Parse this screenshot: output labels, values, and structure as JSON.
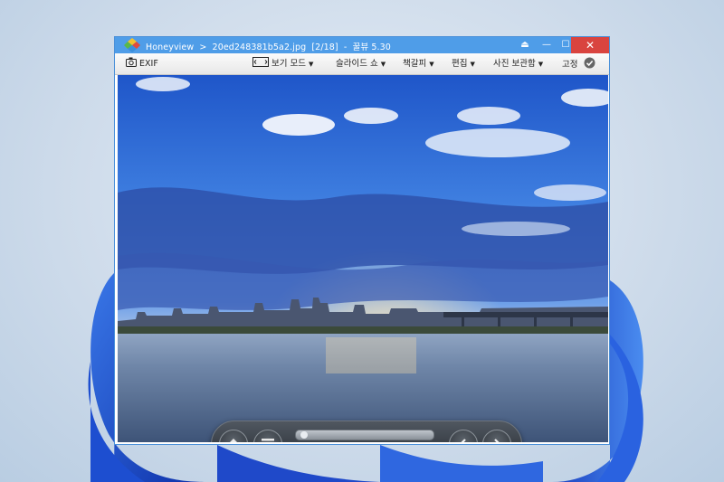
{
  "window": {
    "app_name": "Honeyview",
    "separator": ">",
    "file_name": "20ed248381b5a2.jpg",
    "page_info": "[2/18]",
    "dash": "-",
    "version": "꿀뷰 5.30",
    "close_symbol": "✕",
    "max_symbol": "☐",
    "min_symbol": "—",
    "pin_symbol": "⏏"
  },
  "toolbar": {
    "exif_label": "EXIF",
    "view_mode_label": "보기 모드",
    "slideshow_label": "슬라이드 쇼",
    "bookmark_label": "책갈피",
    "edit_label": "편집",
    "photo_folder_label": "사진 보관함",
    "pin_label": "고정"
  },
  "image": {
    "description_icon": "landscape-photo"
  },
  "controls": {
    "slider_value": 0.02,
    "zoom_in_symbol": "+",
    "zoom_out_symbol": "−",
    "rotate_left_symbol": "↺",
    "rotate_right_symbol": "↻",
    "pin_label": "고정"
  },
  "colors": {
    "titlebar": "#4f9de8",
    "close_button": "#d9443f"
  }
}
